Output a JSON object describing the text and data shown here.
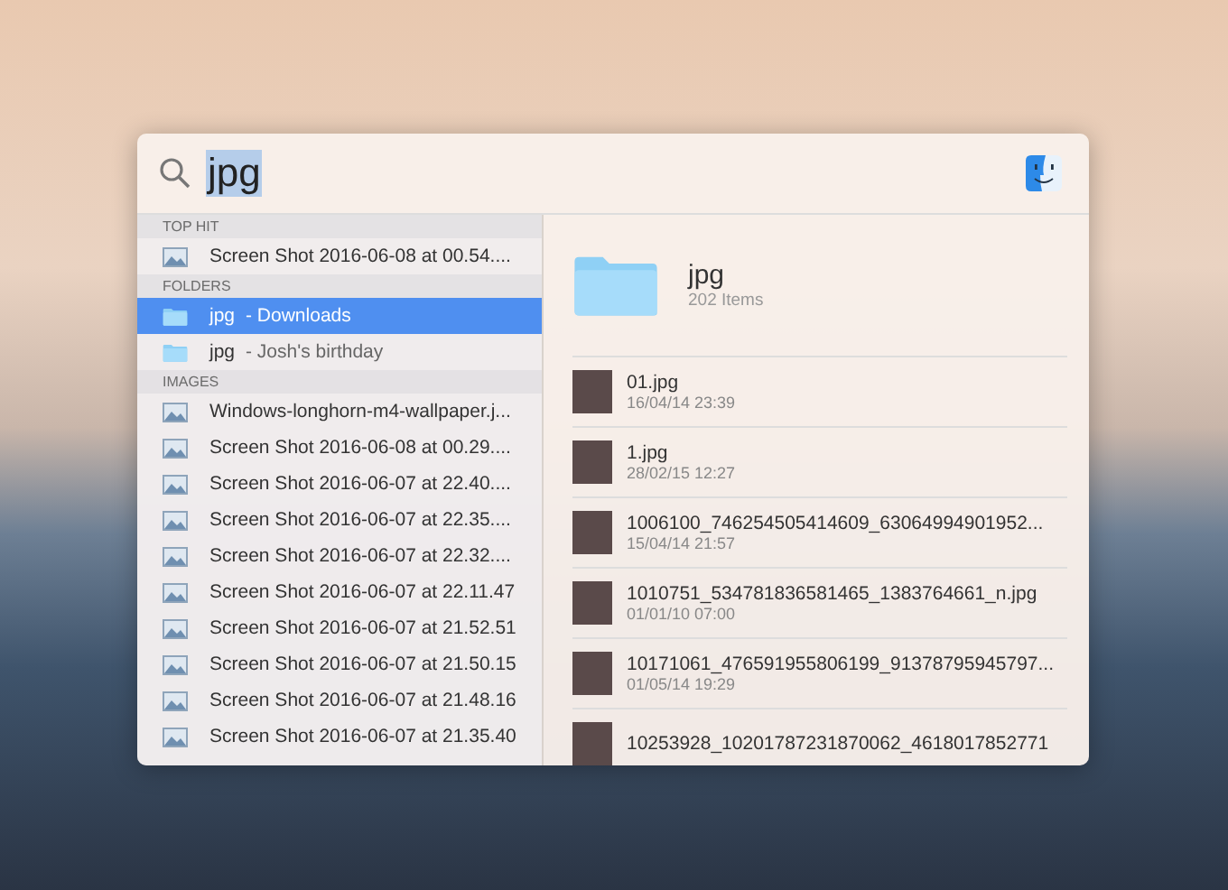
{
  "search": {
    "value": "jpg",
    "selected": true
  },
  "sections": [
    {
      "title": "TOP HIT",
      "items": [
        {
          "kind": "image",
          "name": "Screen Shot 2016-06-08 at 00.54....",
          "selected": false
        }
      ]
    },
    {
      "title": "FOLDERS",
      "items": [
        {
          "kind": "folder",
          "name": "jpg",
          "location": "- Downloads",
          "selected": true
        },
        {
          "kind": "folder",
          "name": "jpg",
          "location": "- Josh's birthday",
          "selected": false
        }
      ]
    },
    {
      "title": "IMAGES",
      "items": [
        {
          "kind": "image",
          "name": "Windows-longhorn-m4-wallpaper.j...",
          "selected": false
        },
        {
          "kind": "image",
          "name": "Screen Shot 2016-06-08 at 00.29....",
          "selected": false
        },
        {
          "kind": "image",
          "name": "Screen Shot 2016-06-07 at 22.40....",
          "selected": false
        },
        {
          "kind": "image",
          "name": "Screen Shot 2016-06-07 at 22.35....",
          "selected": false
        },
        {
          "kind": "image",
          "name": "Screen Shot 2016-06-07 at 22.32....",
          "selected": false
        },
        {
          "kind": "image",
          "name": "Screen Shot 2016-06-07 at 22.11.47",
          "selected": false
        },
        {
          "kind": "image",
          "name": "Screen Shot 2016-06-07 at 21.52.51",
          "selected": false
        },
        {
          "kind": "image",
          "name": "Screen Shot 2016-06-07 at 21.50.15",
          "selected": false
        },
        {
          "kind": "image",
          "name": "Screen Shot 2016-06-07 at 21.48.16",
          "selected": false
        },
        {
          "kind": "image",
          "name": "Screen Shot 2016-06-07 at 21.35.40",
          "selected": false
        }
      ]
    }
  ],
  "preview": {
    "title": "jpg",
    "subtitle": "202 Items",
    "files": [
      {
        "name": "01.jpg",
        "date": "16/04/14 23:39"
      },
      {
        "name": "1.jpg",
        "date": "28/02/15 12:27"
      },
      {
        "name": "1006100_746254505414609_63064994901952...",
        "date": "15/04/14 21:57"
      },
      {
        "name": "1010751_534781836581465_1383764661_n.jpg",
        "date": "01/01/10 07:00"
      },
      {
        "name": "10171061_476591955806199_91378795945797...",
        "date": "01/05/14 19:29"
      },
      {
        "name": "10253928_10201787231870062_4618017852771"
      }
    ]
  }
}
